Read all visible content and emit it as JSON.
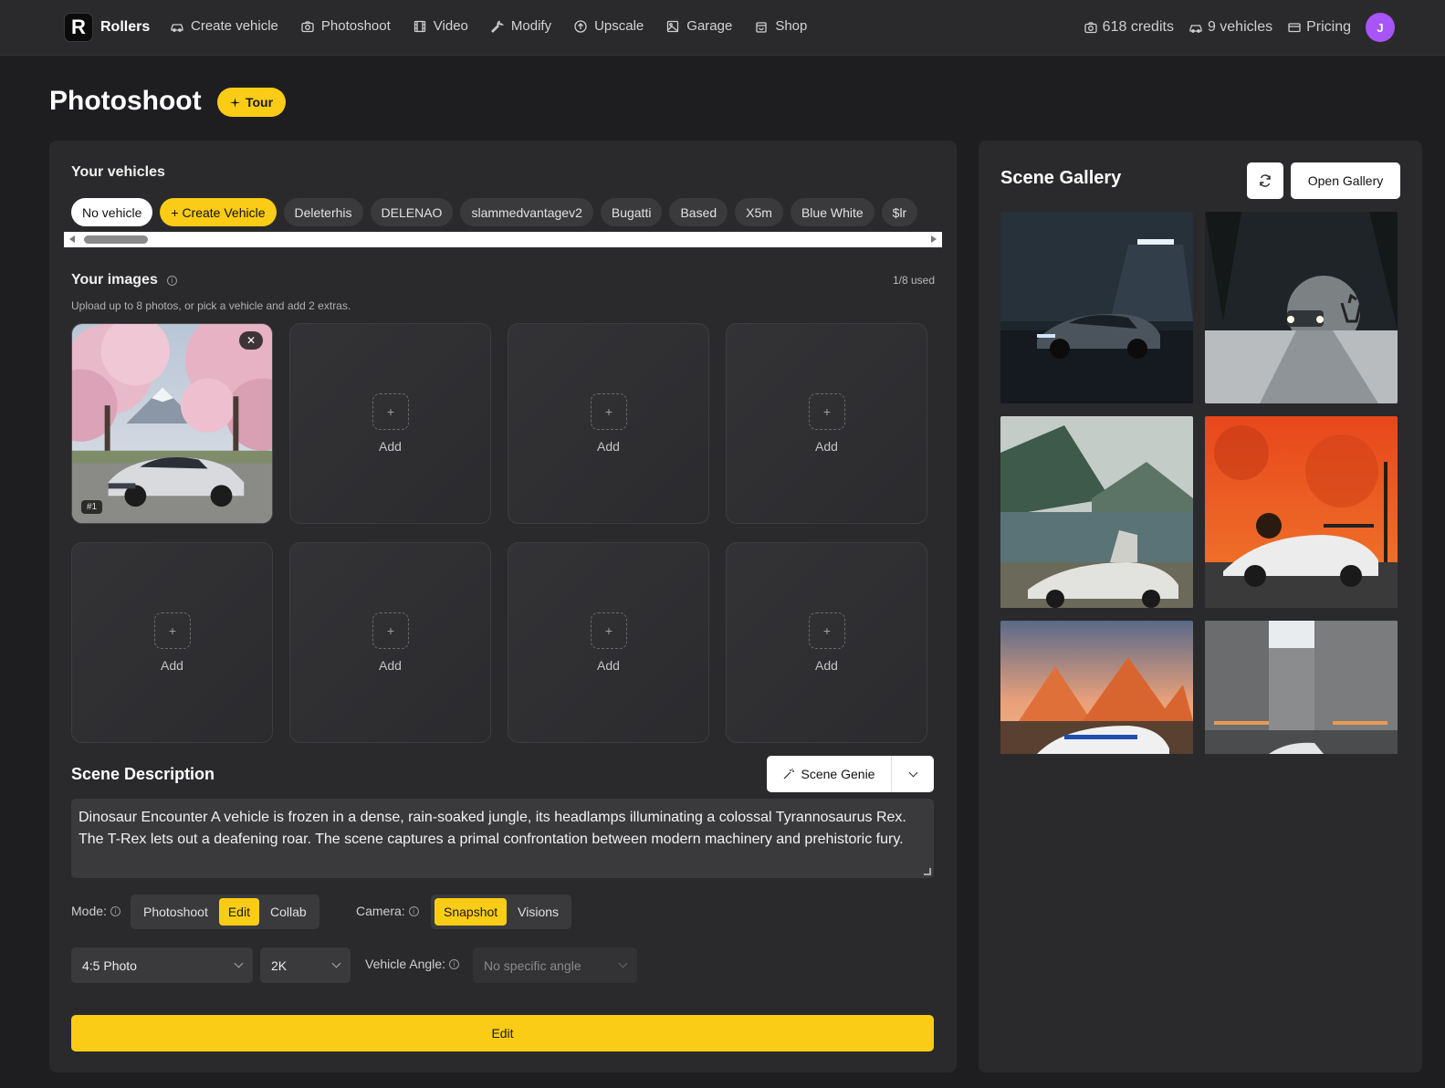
{
  "app": {
    "name": "Rollers",
    "logo_letter": "R"
  },
  "nav": {
    "links": [
      {
        "label": "Create vehicle",
        "icon": "car-icon"
      },
      {
        "label": "Photoshoot",
        "icon": "camera-icon"
      },
      {
        "label": "Video",
        "icon": "film-icon"
      },
      {
        "label": "Modify",
        "icon": "wrench-icon"
      },
      {
        "label": "Upscale",
        "icon": "arrow-up-circle-icon"
      },
      {
        "label": "Garage",
        "icon": "image-icon"
      },
      {
        "label": "Shop",
        "icon": "bag-icon"
      }
    ],
    "credits": "618 credits",
    "vehicles": "9 vehicles",
    "pricing": "Pricing",
    "avatar_letter": "J"
  },
  "page": {
    "title": "Photoshoot",
    "tour_label": "Tour"
  },
  "vehicles": {
    "heading": "Your vehicles",
    "chips": [
      "No vehicle",
      "+ Create Vehicle",
      "Deleterhis",
      "DELENAO",
      "slammedvantagev2",
      "Bugatti",
      "Based",
      "X5m",
      "Blue White",
      "$lr"
    ]
  },
  "images": {
    "heading": "Your images",
    "used": "1/8 used",
    "subtitle": "Upload up to 8 photos, or pick a vehicle and add 2 extras.",
    "add_label": "Add",
    "remove_glyph": "✕",
    "photo_index": "#1",
    "add_glyph": "+"
  },
  "scene": {
    "heading": "Scene Description",
    "genie_label": "Scene Genie",
    "description": "Dinosaur Encounter A vehicle is frozen in a dense, rain-soaked jungle, its headlamps illuminating a colossal Tyrannosaurus Rex. The T-Rex lets out a deafening roar. The scene captures a primal confrontation between modern machinery and prehistoric fury."
  },
  "mode": {
    "label": "Mode:",
    "options": [
      "Photoshoot",
      "Edit",
      "Collab"
    ],
    "selected": "Edit"
  },
  "camera": {
    "label": "Camera:",
    "options": [
      "Snapshot",
      "Visions"
    ],
    "selected": "Snapshot"
  },
  "format": {
    "aspect": "4:5 Photo",
    "resolution": "2K",
    "angle_label": "Vehicle Angle:",
    "angle_value": "No specific angle"
  },
  "submit_label": "Edit",
  "gallery": {
    "title": "Scene Gallery",
    "open_label": "Open Gallery"
  },
  "colors": {
    "accent": "#facc15",
    "avatar": "#a855f7",
    "panel": "#2a2a2c",
    "background": "#1e1e20"
  }
}
